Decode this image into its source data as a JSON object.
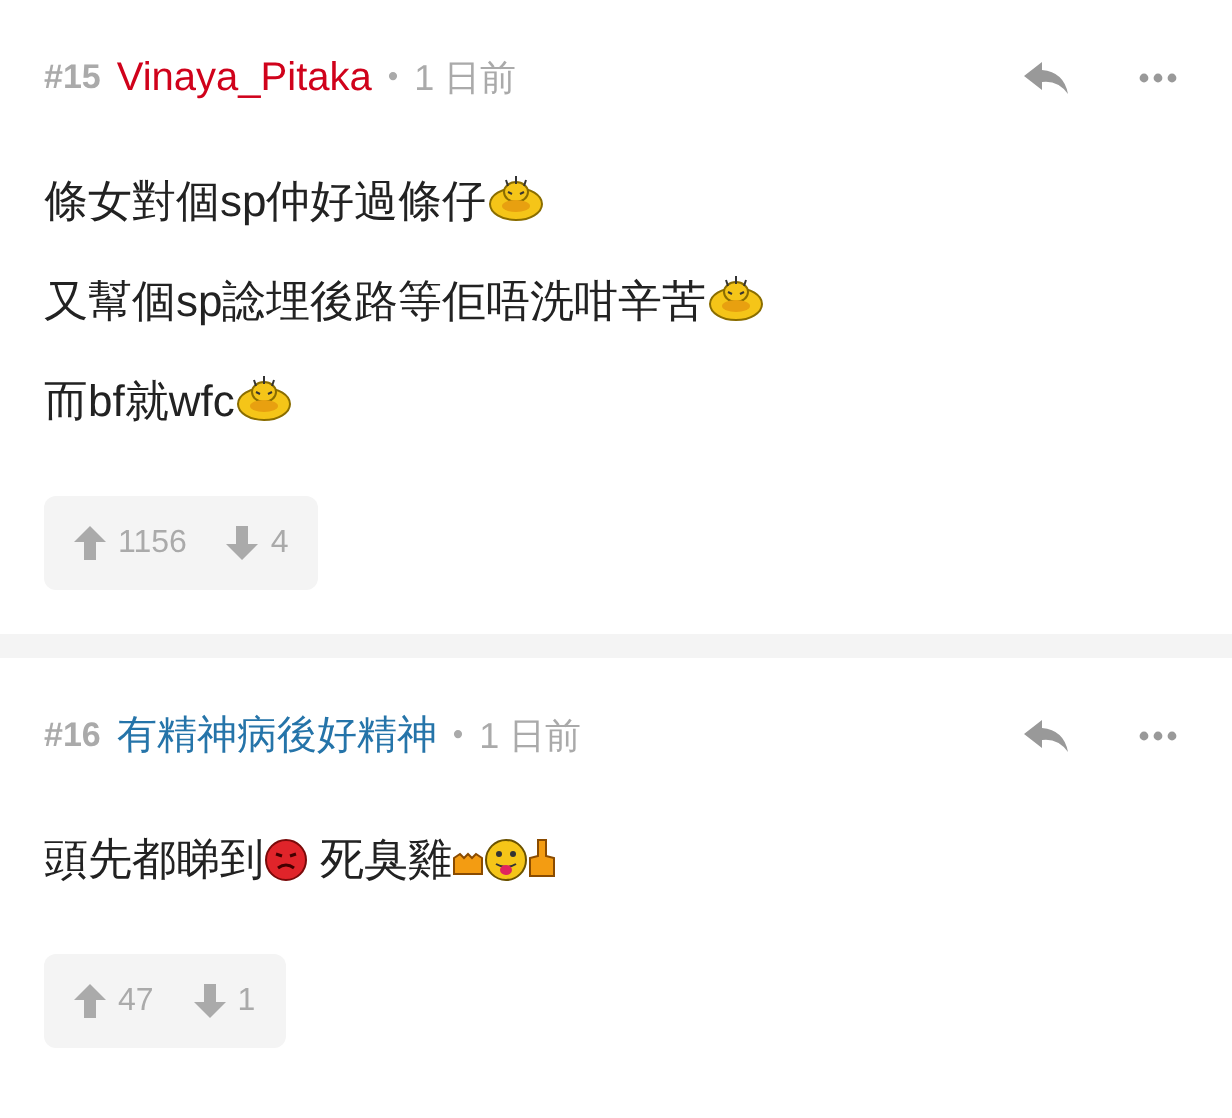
{
  "posts": [
    {
      "number": "#15",
      "author": "Vinaya_Pitaka",
      "color": "#d0021b",
      "separator": "•",
      "time": "1 日前",
      "lines": [
        [
          {
            "kind": "text",
            "text": "條女對個sp仲好過條仔"
          },
          {
            "kind": "sweat"
          }
        ],
        [
          {
            "kind": "text",
            "text": "又幫個sp諗埋後路等佢唔洗咁辛苦"
          },
          {
            "kind": "sweat"
          }
        ],
        [
          {
            "kind": "text",
            "text": "而bf就wfc"
          },
          {
            "kind": "sweat"
          }
        ]
      ],
      "upvotes": "1156",
      "downvotes": "4"
    },
    {
      "number": "#16",
      "author": "有精神病後好精神",
      "color": "#2574a9",
      "separator": "•",
      "time": "1 日前",
      "lines": [
        [
          {
            "kind": "text",
            "text": "頭先都睇到"
          },
          {
            "kind": "angry"
          },
          {
            "kind": "text",
            "text": " 死臭雞"
          },
          {
            "kind": "fist"
          },
          {
            "kind": "tongue"
          },
          {
            "kind": "finger"
          }
        ]
      ],
      "upvotes": "47",
      "downvotes": "1"
    }
  ]
}
